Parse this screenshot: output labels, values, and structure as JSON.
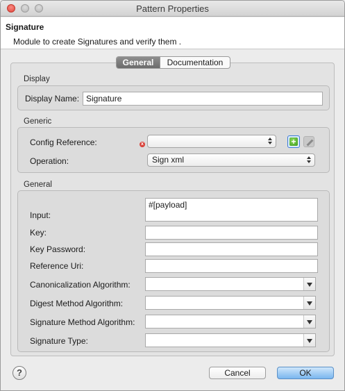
{
  "window": {
    "title": "Pattern Properties"
  },
  "header": {
    "title": "Signature",
    "description": "Module to create Signatures and verify them ."
  },
  "tabs": [
    {
      "label": "General",
      "active": true
    },
    {
      "label": "Documentation",
      "active": false
    }
  ],
  "display": {
    "group_label": "Display",
    "display_name_label": "Display Name:",
    "display_name_value": "Signature"
  },
  "generic": {
    "group_label": "Generic",
    "config_reference_label": "Config Reference:",
    "config_reference_value": "",
    "operation_label": "Operation:",
    "operation_value": "Sign xml",
    "error_icon": "error-icon",
    "add_icon": "add-icon",
    "edit_icon": "pencil-icon"
  },
  "general": {
    "group_label": "General",
    "input_label": "Input:",
    "input_value": "#[payload]",
    "key_label": "Key:",
    "key_value": "",
    "key_password_label": "Key Password:",
    "key_password_value": "",
    "reference_uri_label": "Reference Uri:",
    "reference_uri_value": "",
    "canonicalization_label": "Canonicalization Algorithm:",
    "canonicalization_value": "",
    "digest_label": "Digest Method Algorithm:",
    "digest_value": "",
    "signature_method_label": "Signature Method Algorithm:",
    "signature_method_value": "",
    "signature_type_label": "Signature Type:",
    "signature_type_value": ""
  },
  "footer": {
    "help_icon": "help-icon",
    "help_glyph": "?",
    "cancel_label": "Cancel",
    "ok_label": "OK"
  },
  "colors": {
    "ok_button": "#7ab6ef",
    "error": "#d9423a",
    "add_green": "#3e9c1e"
  }
}
